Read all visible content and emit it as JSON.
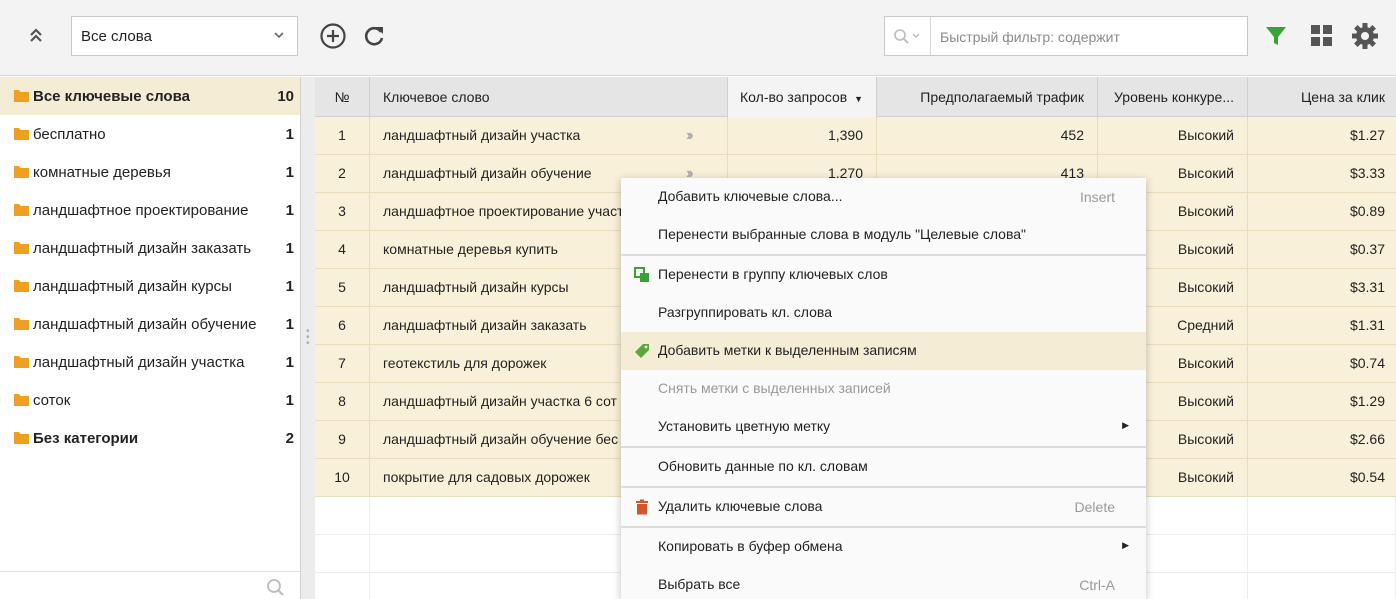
{
  "toolbar": {
    "collapse_icon": "chevrons-up-icon",
    "dropdown_value": "Все слова",
    "add_icon": "plus-circle-icon",
    "refresh_icon": "refresh-icon",
    "filter_placeholder": "Быстрый фильтр: содержит",
    "filter_icon": "funnel-icon",
    "grid_icon": "grid-icon",
    "settings_icon": "gear-icon",
    "accent_color": "#3aa336"
  },
  "sidebar": {
    "items": [
      {
        "label": "Все ключевые слова",
        "count": "10",
        "bold": true,
        "active": true
      },
      {
        "label": "бесплатно",
        "count": "1"
      },
      {
        "label": "комнатные деревья",
        "count": "1"
      },
      {
        "label": "ландшафтное проектирование",
        "count": "1"
      },
      {
        "label": "ландшафтный дизайн заказать",
        "count": "1"
      },
      {
        "label": "ландшафтный дизайн курсы",
        "count": "1"
      },
      {
        "label": "ландшафтный дизайн обучение",
        "count": "1"
      },
      {
        "label": "ландшафтный дизайн участка",
        "count": "1"
      },
      {
        "label": "соток",
        "count": "1"
      },
      {
        "label": "Без категории",
        "count": "2",
        "bold": true
      }
    ],
    "folder_color": "#f0a020"
  },
  "grid": {
    "columns": {
      "num": "№",
      "keyword": "Ключевое слово",
      "requests": "Кол-во запросов",
      "traffic": "Предполагаемый трафик",
      "competition": "Уровень конкуре...",
      "price": "Цена за клик"
    },
    "rows": [
      {
        "num": "1",
        "keyword": "ландшафтный дизайн участка",
        "requests": "1,390",
        "traffic": "452",
        "competition": "Высокий",
        "price": "$1.27"
      },
      {
        "num": "2",
        "keyword": "ландшафтный дизайн обучение",
        "requests": "1,270",
        "traffic": "413",
        "competition": "Высокий",
        "price": "$3.33"
      },
      {
        "num": "3",
        "keyword": "ландшафтное проектирование участ",
        "requests": "",
        "traffic": "",
        "competition": "Высокий",
        "price": "$0.89"
      },
      {
        "num": "4",
        "keyword": "комнатные деревья купить",
        "requests": "",
        "traffic": "",
        "competition": "Высокий",
        "price": "$0.37"
      },
      {
        "num": "5",
        "keyword": "ландшафтный дизайн курсы",
        "requests": "",
        "traffic": "",
        "competition": "Высокий",
        "price": "$3.31"
      },
      {
        "num": "6",
        "keyword": "ландшафтный дизайн заказать",
        "requests": "",
        "traffic": "",
        "competition": "Средний",
        "price": "$1.31"
      },
      {
        "num": "7",
        "keyword": "геотекстиль для дорожек",
        "requests": "",
        "traffic": "",
        "competition": "Высокий",
        "price": "$0.74"
      },
      {
        "num": "8",
        "keyword": "ландшафтный дизайн участка 6 сот",
        "requests": "",
        "traffic": "",
        "competition": "Высокий",
        "price": "$1.29"
      },
      {
        "num": "9",
        "keyword": "ландшафтный дизайн обучение бес",
        "requests": "",
        "traffic": "",
        "competition": "Высокий",
        "price": "$2.66"
      },
      {
        "num": "10",
        "keyword": "покрытие для садовых дорожек",
        "requests": "",
        "traffic": "",
        "competition": "Высокий",
        "price": "$0.54"
      }
    ]
  },
  "context_menu": {
    "add_keywords": {
      "label": "Добавить ключевые слова...",
      "shortcut": "Insert"
    },
    "move_to_target": {
      "label": "Перенести выбранные слова в модуль \"Целевые слова\""
    },
    "move_to_group": {
      "label": "Перенести в группу ключевых слов",
      "icon": "move-group-icon"
    },
    "ungroup": {
      "label": "Разгруппировать кл. слова"
    },
    "add_tags": {
      "label": "Добавить метки к выделенным записям",
      "icon": "tag-icon"
    },
    "remove_tags": {
      "label": "Снять метки с выделенных записей"
    },
    "color_tag": {
      "label": "Установить цветную метку"
    },
    "update_data": {
      "label": "Обновить данные по кл. словам"
    },
    "delete": {
      "label": "Удалить ключевые слова",
      "shortcut": "Delete",
      "icon": "trash-icon"
    },
    "copy": {
      "label": "Копировать в буфер обмена"
    },
    "select_all": {
      "label": "Выбрать все",
      "shortcut": "Ctrl-A"
    }
  }
}
